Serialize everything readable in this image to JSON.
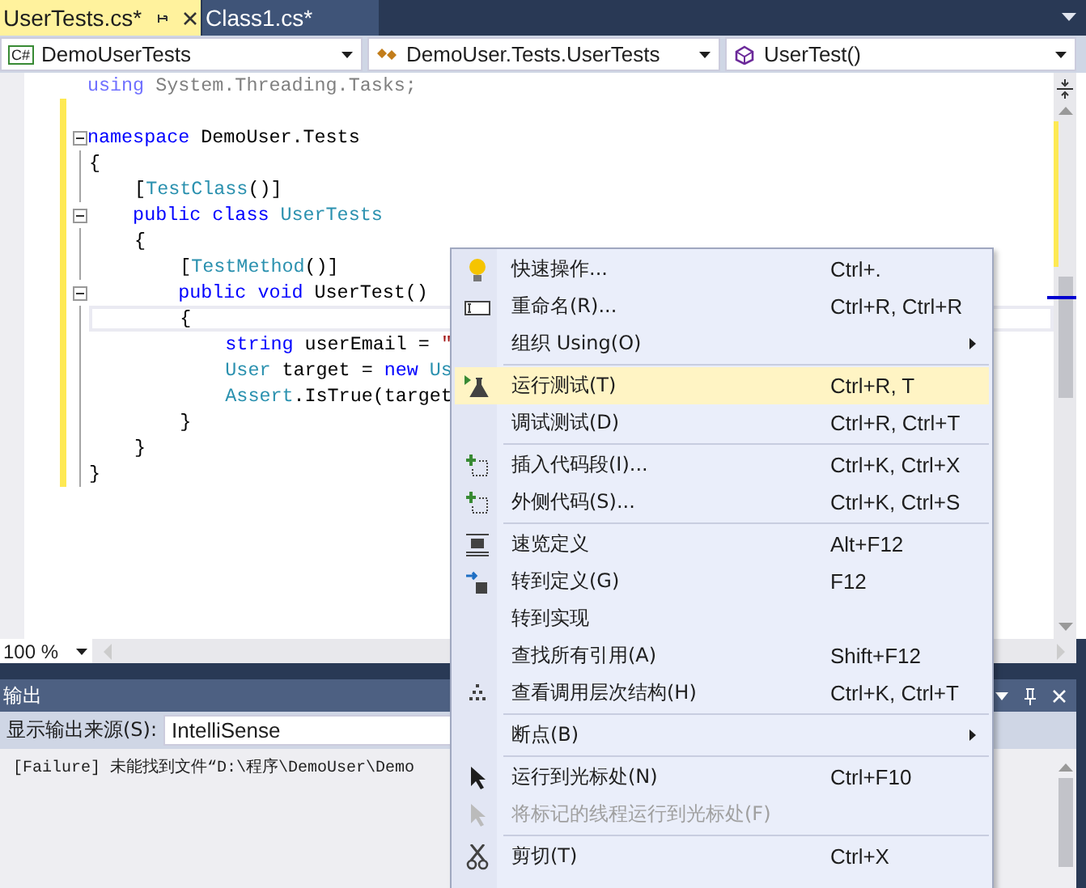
{
  "tabs": [
    {
      "label": "UserTests.cs*",
      "selected": true
    },
    {
      "label": "Class1.cs*",
      "selected": false
    }
  ],
  "navbar": {
    "project_badge": "C#",
    "project": "DemoUserTests",
    "type": "DemoUser.Tests.UserTests",
    "member": "UserTest()"
  },
  "editor": {
    "lines": [
      {
        "kind": "code",
        "changed": false,
        "fold": false,
        "current": false,
        "tokens": [
          {
            "kind": "dimkeyword",
            "text": "using"
          },
          {
            "kind": "dim",
            "text": " System.Threading.Tasks;"
          }
        ]
      },
      {
        "kind": "blank",
        "changed": true,
        "fold": false,
        "current": false
      },
      {
        "kind": "code",
        "changed": true,
        "fold": true,
        "current": false,
        "tokens": [
          {
            "kind": "keyword",
            "text": "namespace"
          },
          {
            "kind": "plain",
            "text": " DemoUser.Tests"
          }
        ]
      },
      {
        "kind": "code",
        "changed": true,
        "fold": false,
        "current": false,
        "tokens": [
          {
            "kind": "plain",
            "text": "{"
          }
        ]
      },
      {
        "kind": "code",
        "changed": true,
        "fold": false,
        "current": false,
        "tokens": [
          {
            "kind": "plain",
            "text": "    ["
          },
          {
            "kind": "type",
            "text": "TestClass"
          },
          {
            "kind": "plain",
            "text": "()]"
          }
        ]
      },
      {
        "kind": "code",
        "changed": true,
        "fold": true,
        "current": false,
        "tokens": [
          {
            "kind": "keyword",
            "text": "    public class "
          },
          {
            "kind": "type",
            "text": "UserTests"
          }
        ]
      },
      {
        "kind": "code",
        "changed": true,
        "fold": false,
        "current": false,
        "tokens": [
          {
            "kind": "plain",
            "text": "    {"
          }
        ]
      },
      {
        "kind": "code",
        "changed": true,
        "fold": false,
        "current": false,
        "tokens": [
          {
            "kind": "plain",
            "text": "        ["
          },
          {
            "kind": "type",
            "text": "TestMethod"
          },
          {
            "kind": "plain",
            "text": "()]"
          }
        ]
      },
      {
        "kind": "code",
        "changed": true,
        "fold": true,
        "current": false,
        "tokens": [
          {
            "kind": "keyword",
            "text": "        public void"
          },
          {
            "kind": "plain",
            "text": " UserTest()"
          }
        ]
      },
      {
        "kind": "code",
        "changed": true,
        "fold": false,
        "current": true,
        "tokens": [
          {
            "kind": "plain",
            "text": "        {"
          }
        ]
      },
      {
        "kind": "code",
        "changed": true,
        "fold": false,
        "current": false,
        "tokens": [
          {
            "kind": "keyword",
            "text": "            string"
          },
          {
            "kind": "plain",
            "text": " userEmail = "
          },
          {
            "kind": "string",
            "text": "\""
          }
        ]
      },
      {
        "kind": "code",
        "changed": true,
        "fold": false,
        "current": false,
        "tokens": [
          {
            "kind": "type",
            "text": "            User"
          },
          {
            "kind": "plain",
            "text": " target = "
          },
          {
            "kind": "keyword",
            "text": "new "
          },
          {
            "kind": "type",
            "text": "Us"
          }
        ]
      },
      {
        "kind": "code",
        "changed": true,
        "fold": false,
        "current": false,
        "tokens": [
          {
            "kind": "type",
            "text": "            Assert"
          },
          {
            "kind": "plain",
            "text": ".IsTrue(target"
          }
        ]
      },
      {
        "kind": "code",
        "changed": true,
        "fold": false,
        "current": false,
        "tokens": [
          {
            "kind": "plain",
            "text": "        }"
          }
        ]
      },
      {
        "kind": "code",
        "changed": true,
        "fold": false,
        "current": false,
        "tokens": [
          {
            "kind": "plain",
            "text": "    }"
          }
        ]
      },
      {
        "kind": "code",
        "changed": true,
        "fold": false,
        "current": false,
        "tokens": [
          {
            "kind": "plain",
            "text": "}"
          }
        ]
      }
    ],
    "zoom": "100 %"
  },
  "output": {
    "title": "输出",
    "source_label": "显示输出来源(S):",
    "source": "IntelliSense",
    "text": "[Failure] 未能找到文件“D:\\程序\\DemoUser\\Demo"
  },
  "context_menu": [
    {
      "kind": "item",
      "label": "快速操作...",
      "shortcut": "Ctrl+.",
      "submenu": false,
      "disabled": false,
      "selected": false
    },
    {
      "kind": "item",
      "label": "重命名(R)...",
      "shortcut": "Ctrl+R, Ctrl+R",
      "submenu": false,
      "disabled": false,
      "selected": false
    },
    {
      "kind": "item",
      "label": "组织 Using(O)",
      "submenu": true,
      "disabled": false,
      "selected": false
    },
    {
      "kind": "separator"
    },
    {
      "kind": "item",
      "label": "运行测试(T)",
      "shortcut": "Ctrl+R, T",
      "submenu": false,
      "disabled": false,
      "selected": true
    },
    {
      "kind": "item",
      "label": "调试测试(D)",
      "shortcut": "Ctrl+R, Ctrl+T",
      "submenu": false,
      "disabled": false,
      "selected": false
    },
    {
      "kind": "separator"
    },
    {
      "kind": "item",
      "label": "插入代码段(I)...",
      "shortcut": "Ctrl+K, Ctrl+X",
      "submenu": false,
      "disabled": false,
      "selected": false
    },
    {
      "kind": "item",
      "label": "外侧代码(S)...",
      "shortcut": "Ctrl+K, Ctrl+S",
      "submenu": false,
      "disabled": false,
      "selected": false
    },
    {
      "kind": "separator"
    },
    {
      "kind": "item",
      "label": "速览定义",
      "shortcut": "Alt+F12",
      "submenu": false,
      "disabled": false,
      "selected": false
    },
    {
      "kind": "item",
      "label": "转到定义(G)",
      "shortcut": "F12",
      "submenu": false,
      "disabled": false,
      "selected": false
    },
    {
      "kind": "item",
      "label": "转到实现",
      "submenu": false,
      "disabled": false,
      "selected": false
    },
    {
      "kind": "item",
      "label": "查找所有引用(A)",
      "shortcut": "Shift+F12",
      "submenu": false,
      "disabled": false,
      "selected": false
    },
    {
      "kind": "item",
      "label": "查看调用层次结构(H)",
      "shortcut": "Ctrl+K, Ctrl+T",
      "submenu": false,
      "disabled": false,
      "selected": false
    },
    {
      "kind": "separator"
    },
    {
      "kind": "item",
      "label": "断点(B)",
      "submenu": true,
      "disabled": false,
      "selected": false
    },
    {
      "kind": "separator"
    },
    {
      "kind": "item",
      "label": "运行到光标处(N)",
      "shortcut": "Ctrl+F10",
      "submenu": false,
      "disabled": false,
      "selected": false
    },
    {
      "kind": "item",
      "label": "将标记的线程运行到光标处(F)",
      "submenu": false,
      "disabled": true,
      "selected": false
    },
    {
      "kind": "separator"
    },
    {
      "kind": "item",
      "label": "剪切(T)",
      "shortcut": "Ctrl+X",
      "submenu": false,
      "disabled": false,
      "selected": false
    }
  ]
}
